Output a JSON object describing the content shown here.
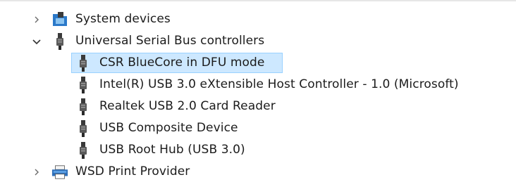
{
  "tree": {
    "items": [
      {
        "label": "System devices",
        "icon": "folder-chip-icon",
        "expanded": false
      },
      {
        "label": "Universal Serial Bus controllers",
        "icon": "usb-plug-icon",
        "expanded": true
      },
      {
        "label": "CSR BlueCore in DFU mode",
        "icon": "usb-plug-icon",
        "selected": true
      },
      {
        "label": "Intel(R) USB 3.0 eXtensible Host Controller - 1.0 (Microsoft)",
        "icon": "usb-plug-icon"
      },
      {
        "label": "Realtek USB 2.0 Card Reader",
        "icon": "usb-plug-icon"
      },
      {
        "label": "USB Composite Device",
        "icon": "usb-plug-icon"
      },
      {
        "label": "USB Root Hub (USB 3.0)",
        "icon": "usb-plug-icon"
      },
      {
        "label": "WSD Print Provider",
        "icon": "printer-icon",
        "expanded": false
      }
    ]
  },
  "colors": {
    "selection_fill": "#cde8ff",
    "selection_border": "#99d1ff",
    "text": "#1b1b1b"
  }
}
